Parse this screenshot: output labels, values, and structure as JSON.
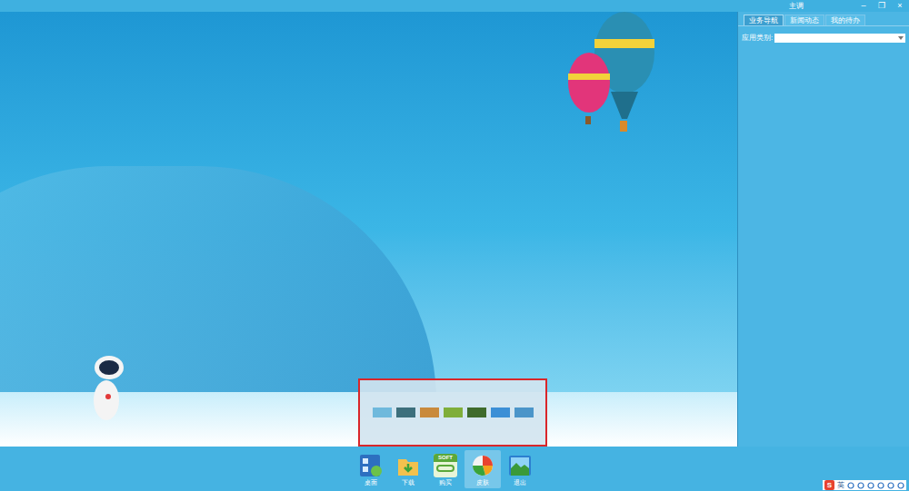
{
  "window": {
    "title": "主调",
    "controls": [
      "–",
      "❐",
      "×"
    ]
  },
  "tabs": [
    {
      "label": "业务导航",
      "selected": true
    },
    {
      "label": "新闻动态",
      "selected": false
    },
    {
      "label": "我的待办",
      "selected": false
    }
  ],
  "filter": {
    "label": "应用类别:",
    "value": ""
  },
  "skin_popup": {
    "skins": [
      {
        "color": "#6fb9dc",
        "selected": false
      },
      {
        "color": "#3d6f7c",
        "selected": false
      },
      {
        "color": "#c98a3c",
        "selected": false
      },
      {
        "color": "#7fae3a",
        "selected": false
      },
      {
        "color": "#3f6b2c",
        "selected": false
      },
      {
        "color": "#3c8fd6",
        "selected": false
      },
      {
        "color": "#4b95c9",
        "selected": false
      }
    ]
  },
  "taskbar": [
    {
      "label": "桌面",
      "selected": false
    },
    {
      "label": "下载",
      "selected": false
    },
    {
      "label": "购买",
      "badge": "SOFT",
      "selected": false
    },
    {
      "label": "皮肤",
      "selected": true
    },
    {
      "label": "退出",
      "selected": false
    }
  ],
  "tray": {
    "logo": "S",
    "lang": "英"
  }
}
